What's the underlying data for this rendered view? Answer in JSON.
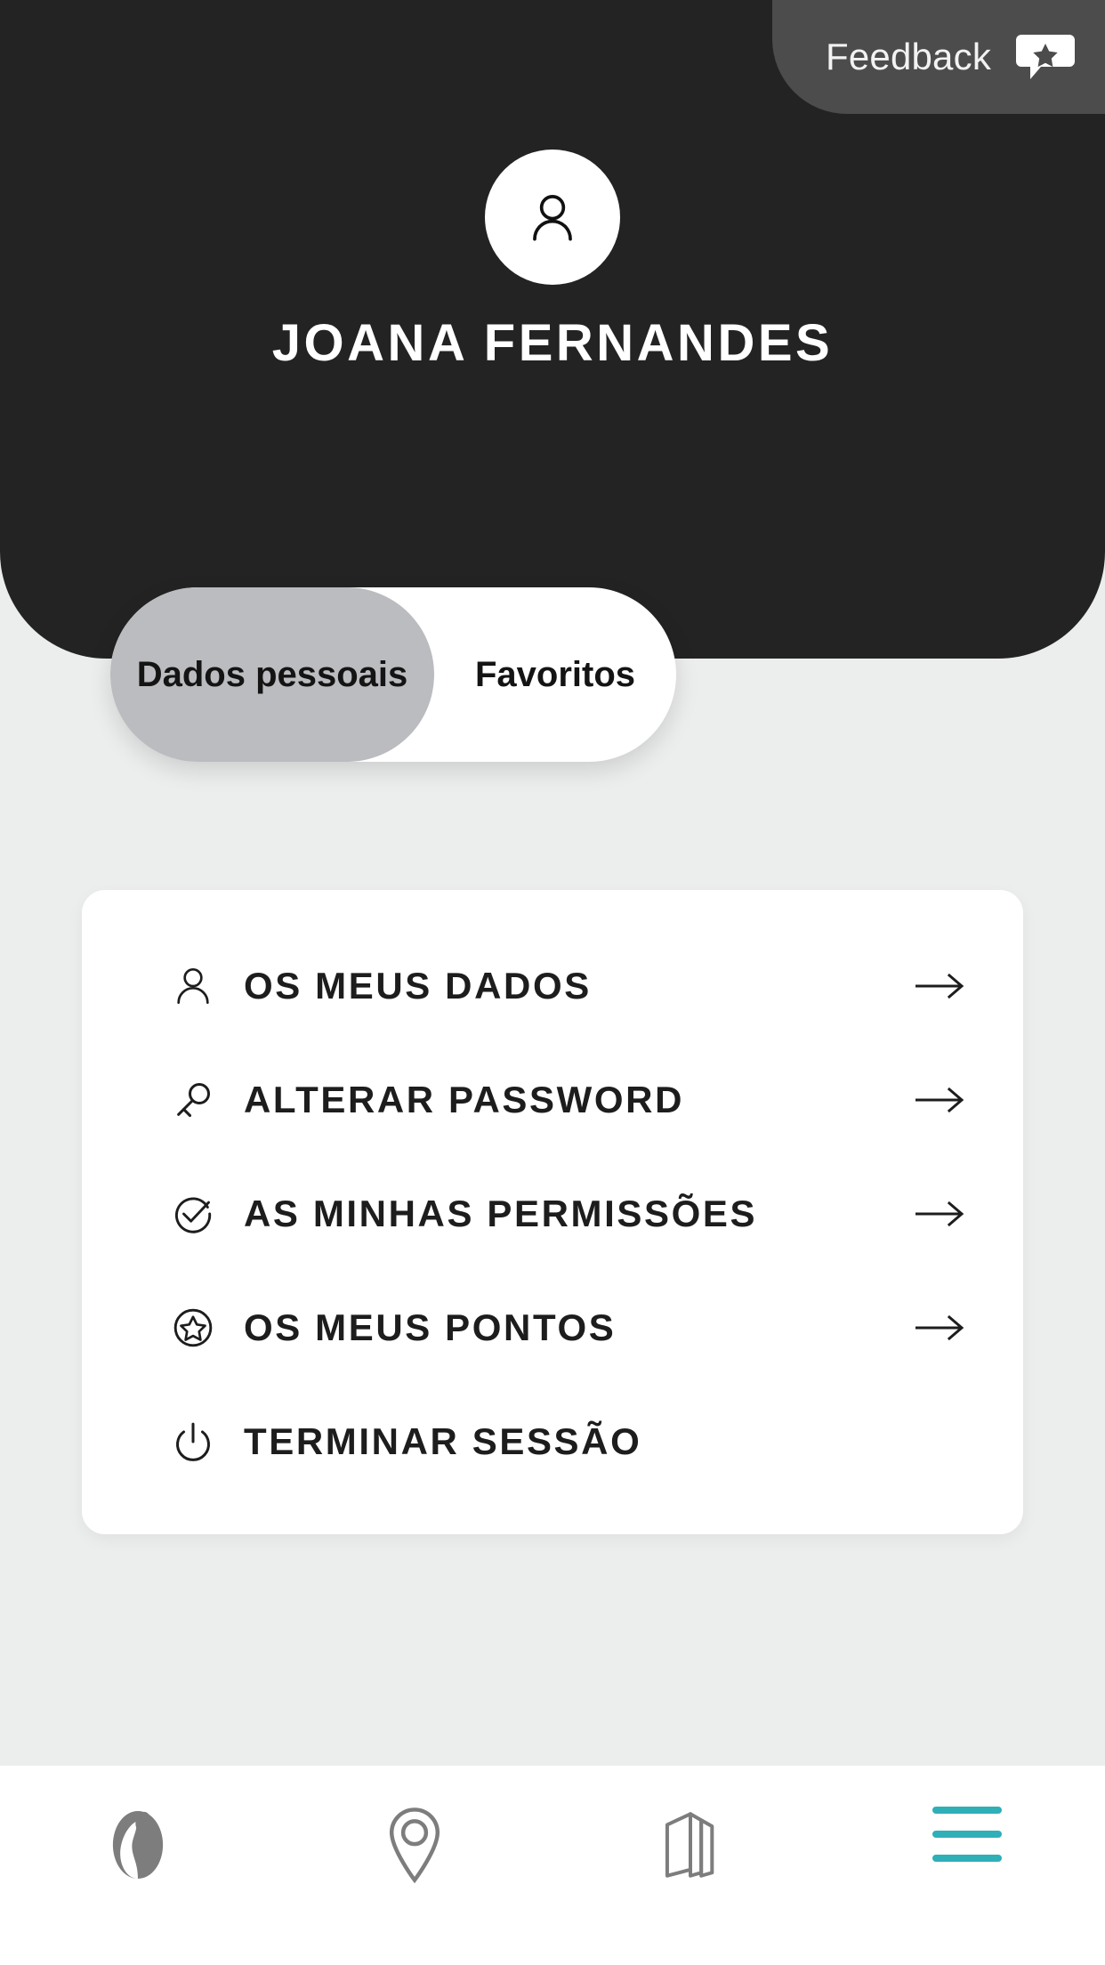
{
  "header": {
    "feedback": {
      "label": "Feedback",
      "icon": "speech-bubble-star-icon"
    },
    "avatar_icon": "person-icon",
    "profile_name": "JOANA FERNANDES",
    "background_color": "#232323"
  },
  "tabs": {
    "active_index": 0,
    "items": [
      {
        "label": "Dados pessoais",
        "active": true
      },
      {
        "label": "Favoritos",
        "active": false
      }
    ],
    "active_pill_color": "#bbbcbf",
    "track_color": "#ffffff"
  },
  "menu": {
    "items": [
      {
        "label": "OS MEUS DADOS",
        "icon": "person-icon",
        "has_arrow": true
      },
      {
        "label": "ALTERAR PASSWORD",
        "icon": "key-icon",
        "has_arrow": true
      },
      {
        "label": "AS MINHAS PERMISSÕES",
        "icon": "check-circle-icon",
        "has_arrow": true
      },
      {
        "label": "OS MEUS PONTOS",
        "icon": "star-circle-icon",
        "has_arrow": true
      },
      {
        "label": "TERMINAR SESSÃO",
        "icon": "power-icon",
        "has_arrow": false
      }
    ],
    "arrow_glyph": "→"
  },
  "bottom_nav": {
    "active_color": "#2fafb8",
    "inactive_color": "#7d7d7d",
    "items": [
      {
        "name": "home-logo",
        "icon": "brand-logo-icon",
        "active": false
      },
      {
        "name": "locations",
        "icon": "map-pin-icon",
        "active": false
      },
      {
        "name": "catalog",
        "icon": "brochure-icon",
        "active": false
      },
      {
        "name": "menu",
        "icon": "hamburger-icon",
        "active": true
      }
    ]
  }
}
